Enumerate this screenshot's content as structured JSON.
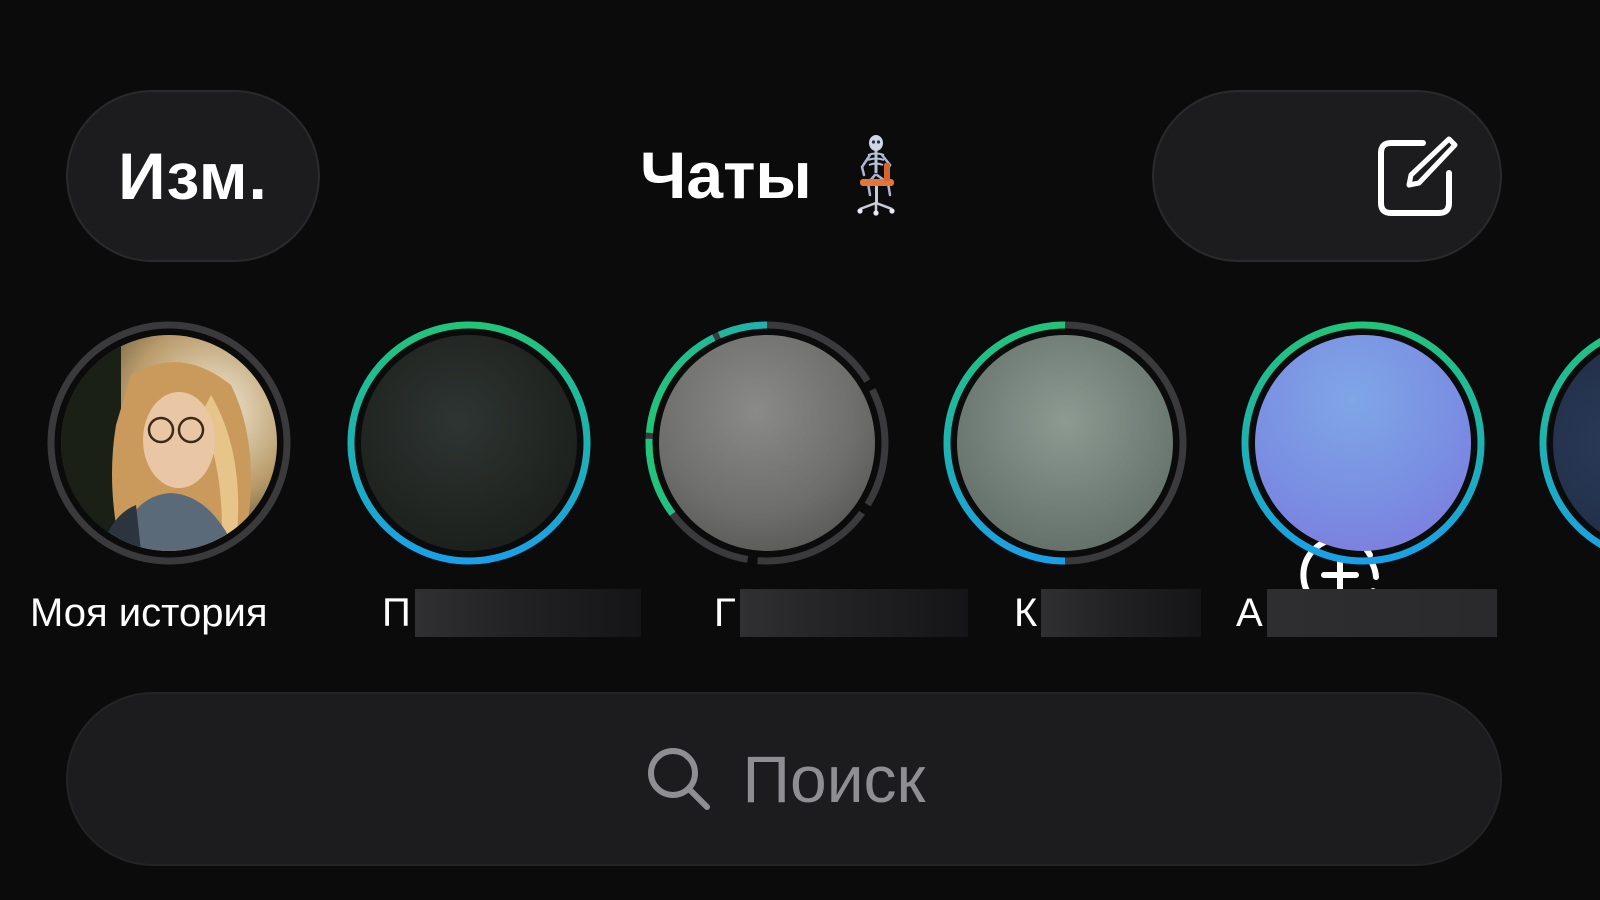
{
  "header": {
    "edit_label": "Изм.",
    "title": "Чаты",
    "status_emoji": "skeleton-on-chair",
    "actions": [
      {
        "name": "add-story",
        "icon": "circle-plus-dashed-icon"
      },
      {
        "name": "compose",
        "icon": "pencil-square-icon"
      }
    ]
  },
  "stories": [
    {
      "label": "Моя история",
      "kind": "own",
      "ring": "none"
    },
    {
      "initial": "П",
      "kind": "contact",
      "ring": "unread"
    },
    {
      "initial": "Г",
      "kind": "contact",
      "ring": "partially-viewed"
    },
    {
      "initial": "К",
      "kind": "contact",
      "ring": "partially-viewed"
    },
    {
      "initial": "А",
      "kind": "contact",
      "ring": "unread"
    }
  ],
  "search": {
    "placeholder": "Поиск",
    "icon": "search-icon"
  },
  "colors": {
    "background": "#0b0b0c",
    "pill": "#1c1c1e",
    "ring_gradient_start": "#22c47a",
    "ring_gradient_end": "#1aa0e8",
    "ring_viewed": "#3a3a3c",
    "placeholder": "#8e8e93"
  }
}
